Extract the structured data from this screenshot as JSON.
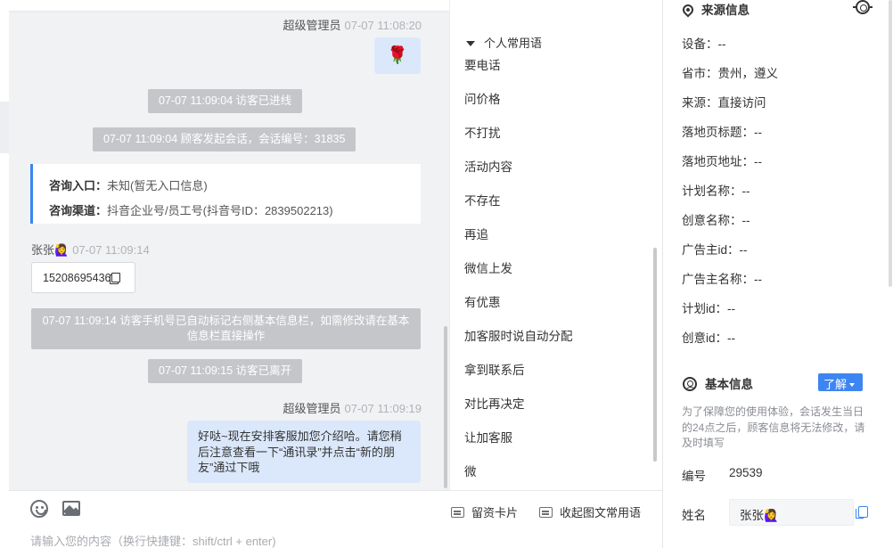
{
  "chat": {
    "messages": {
      "agent_name_1": "超级管理员",
      "agent_time_1": "07-07 11:08:20",
      "rose_emoji": "🌹",
      "sys_1": "07-07 11:09:04 访客已进线",
      "sys_2": "07-07 11:09:04 顾客发起会话，会话编号：31835",
      "entry_label": "咨询入口：",
      "entry_value": "未知(暂无入口信息)",
      "channel_label": "咨询渠道：",
      "channel_value": "抖音企业号/员工号(抖音号ID：2839502213)",
      "visitor_name": "张张🙋‍♀️",
      "visitor_time": "07-07 11:09:14",
      "phone": "15208695436",
      "sys_3": "07-07 11:09:14 访客手机号已自动标记右侧基本信息栏，如需修改请在基本信息栏直接操作",
      "sys_4": "07-07 11:09:15 访客已离开",
      "agent_name_2": "超级管理员",
      "agent_time_2": "07-07 11:09:19",
      "agent_reply": "好哒~现在安排客服加您介绍哈。请您稍后注意查看一下“通讯录”并点击“新的朋友”通过下哦"
    },
    "input": {
      "placeholder": "请输入您的内容（换行快捷键：shift/ctrl + enter)"
    },
    "toolbar": {
      "card_label": "留资卡片",
      "fold_label": "收起图文常用语"
    }
  },
  "phrases": {
    "header": "个人常用语",
    "items": [
      "要电话",
      "问价格",
      "不打扰",
      "活动内容",
      "不存在",
      "再追",
      "微信上发",
      "有优惠",
      "加客服时说自动分配",
      "拿到联系后",
      "对比再决定",
      "让加客服",
      "微"
    ]
  },
  "side": {
    "source_title": "来源信息",
    "source_rows": [
      "设备：--",
      "省市：贵州，遵义",
      "来源：直接访问",
      "落地页标题：--",
      "落地页地址：--",
      "计划名称：--",
      "创意名称：--",
      "广告主id：--",
      "广告主名称：--",
      "计划id：--",
      "创意id：--"
    ],
    "basic_title": "基本信息",
    "learn_label": "了解",
    "notice": "为了保障您的使用体验，会话发生当日的24点之后，顾客信息将无法修改，请及时填写",
    "id_label": "编号",
    "id_value": "29539",
    "name_label": "姓名",
    "name_value": "张张🙋‍♀️"
  },
  "colors": {
    "accent": "#3d86f2",
    "chat_bg": "#f1f2f4",
    "system_msg_bg": "#c4c6c9",
    "agent_bubble": "#dbe8fb"
  }
}
